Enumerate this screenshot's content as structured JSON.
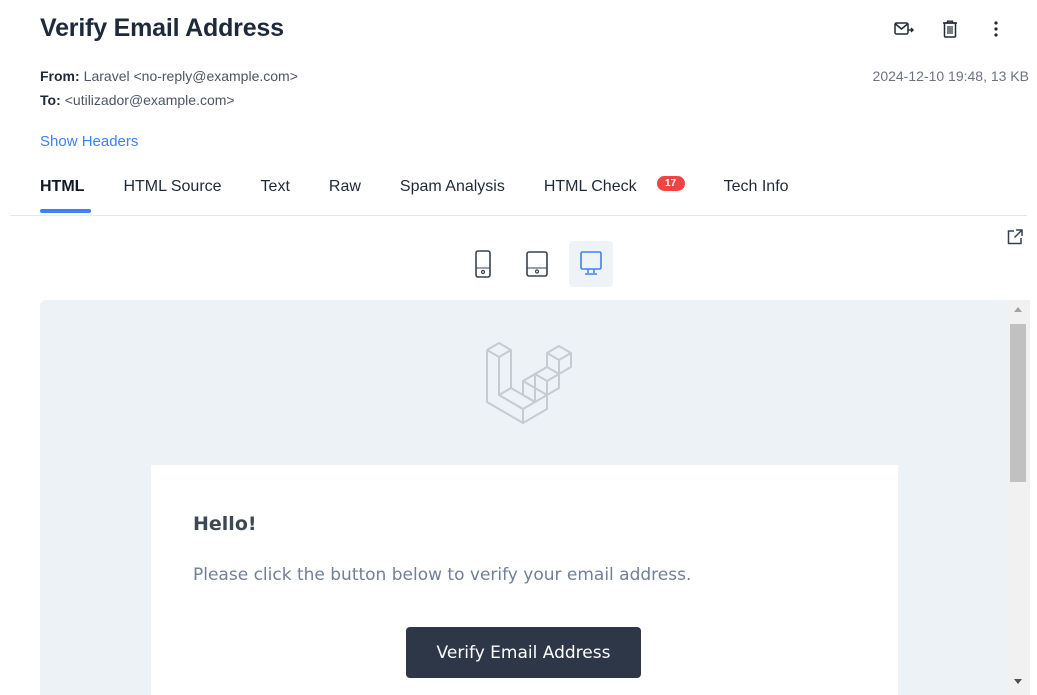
{
  "header": {
    "title": "Verify Email Address",
    "actions": [
      {
        "name": "forward-icon",
        "label": "Forward"
      },
      {
        "name": "trash-icon",
        "label": "Delete"
      },
      {
        "name": "more-vertical-icon",
        "label": "More"
      }
    ]
  },
  "meta": {
    "from_label": "From:",
    "from_value": "Laravel <no-reply@example.com>",
    "to_label": "To:",
    "to_value": "<utilizador@example.com>",
    "date_size": "2024-12-10 19:48, 13 KB"
  },
  "show_headers": "Show Headers",
  "tabs": [
    {
      "label": "HTML",
      "active": true
    },
    {
      "label": "HTML Source"
    },
    {
      "label": "Text"
    },
    {
      "label": "Raw"
    },
    {
      "label": "Spam Analysis"
    },
    {
      "label": "HTML Check",
      "badge": "17"
    },
    {
      "label": "Tech Info"
    }
  ],
  "devices": [
    {
      "name": "phone-icon",
      "active": false
    },
    {
      "name": "tablet-icon",
      "active": false
    },
    {
      "name": "desktop-icon",
      "active": true
    }
  ],
  "email": {
    "greeting": "Hello!",
    "body": "Please click the button below to verify your email address.",
    "button": "Verify Email Address"
  },
  "colors": {
    "accent": "#3b82f6",
    "badge": "#ef4444",
    "preview_bg": "#edf2f7",
    "button_bg": "#2d3748"
  }
}
